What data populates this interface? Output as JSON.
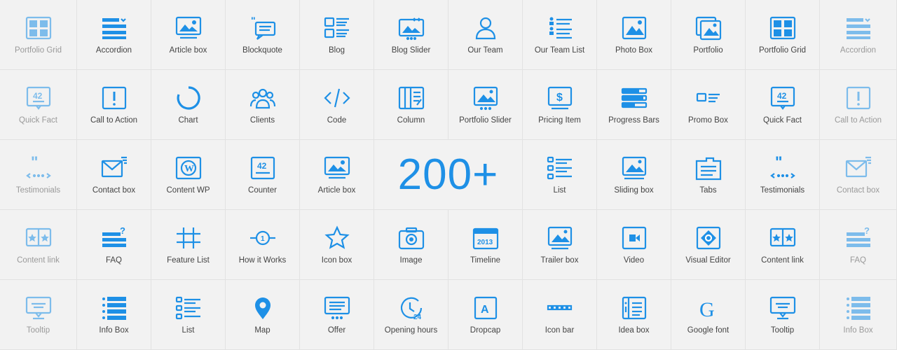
{
  "accent": "#1e90e6",
  "headline": "200+",
  "rows": [
    [
      {
        "label": "Portfolio Grid",
        "icon": "portfolio-grid",
        "faded": true
      },
      {
        "label": "Accordion",
        "icon": "accordion"
      },
      {
        "label": "Article box",
        "icon": "article-box"
      },
      {
        "label": "Blockquote",
        "icon": "blockquote"
      },
      {
        "label": "Blog",
        "icon": "blog"
      },
      {
        "label": "Blog Slider",
        "icon": "blog-slider"
      },
      {
        "label": "Our Team",
        "icon": "our-team"
      },
      {
        "label": "Our Team List",
        "icon": "our-team-list"
      },
      {
        "label": "Photo Box",
        "icon": "photo-box"
      },
      {
        "label": "Portfolio",
        "icon": "portfolio"
      },
      {
        "label": "Portfolio Grid",
        "icon": "portfolio-grid"
      },
      {
        "label": "Accordion",
        "icon": "accordion",
        "faded": true
      }
    ],
    [
      {
        "label": "Quick Fact",
        "icon": "quick-fact",
        "faded": true
      },
      {
        "label": "Call to Action",
        "icon": "call-to-action"
      },
      {
        "label": "Chart",
        "icon": "chart"
      },
      {
        "label": "Clients",
        "icon": "clients"
      },
      {
        "label": "Code",
        "icon": "code"
      },
      {
        "label": "Column",
        "icon": "column"
      },
      {
        "label": "Portfolio Slider",
        "icon": "portfolio-slider"
      },
      {
        "label": "Pricing Item",
        "icon": "pricing-item"
      },
      {
        "label": "Progress Bars",
        "icon": "progress-bars"
      },
      {
        "label": "Promo Box",
        "icon": "promo-box"
      },
      {
        "label": "Quick Fact",
        "icon": "quick-fact"
      },
      {
        "label": "Call to Action",
        "icon": "call-to-action",
        "faded": true
      }
    ],
    [
      {
        "label": "Testimonials",
        "icon": "testimonials",
        "faded": true
      },
      {
        "label": "Contact box",
        "icon": "contact-box"
      },
      {
        "label": "Content WP",
        "icon": "content-wp"
      },
      {
        "label": "Counter",
        "icon": "counter"
      },
      {
        "label": "Article box",
        "icon": "article-box"
      },
      null,
      null,
      {
        "label": "List",
        "icon": "list"
      },
      {
        "label": "Sliding box",
        "icon": "sliding-box"
      },
      {
        "label": "Tabs",
        "icon": "tabs"
      },
      {
        "label": "Testimonials",
        "icon": "testimonials"
      },
      {
        "label": "Contact box",
        "icon": "contact-box",
        "faded": true
      }
    ],
    [
      {
        "label": "Content link",
        "icon": "content-link",
        "faded": true
      },
      {
        "label": "FAQ",
        "icon": "faq"
      },
      {
        "label": "Feature List",
        "icon": "feature-list"
      },
      {
        "label": "How it Works",
        "icon": "how-it-works"
      },
      {
        "label": "Icon box",
        "icon": "icon-box"
      },
      {
        "label": "Image",
        "icon": "image"
      },
      {
        "label": "Timeline",
        "icon": "timeline"
      },
      {
        "label": "Trailer box",
        "icon": "trailer-box"
      },
      {
        "label": "Video",
        "icon": "video"
      },
      {
        "label": "Visual Editor",
        "icon": "visual-editor"
      },
      {
        "label": "Content link",
        "icon": "content-link"
      },
      {
        "label": "FAQ",
        "icon": "faq",
        "faded": true
      }
    ],
    [
      {
        "label": "Tooltip",
        "icon": "tooltip",
        "faded": true
      },
      {
        "label": "Info Box",
        "icon": "info-box"
      },
      {
        "label": "List",
        "icon": "list"
      },
      {
        "label": "Map",
        "icon": "map"
      },
      {
        "label": "Offer",
        "icon": "offer"
      },
      {
        "label": "Opening hours",
        "icon": "opening-hours"
      },
      {
        "label": "Dropcap",
        "icon": "dropcap"
      },
      {
        "label": "Icon bar",
        "icon": "icon-bar"
      },
      {
        "label": "Idea box",
        "icon": "idea-box"
      },
      {
        "label": "Google font",
        "icon": "google-font"
      },
      {
        "label": "Tooltip",
        "icon": "tooltip"
      },
      {
        "label": "Info Box",
        "icon": "info-box",
        "faded": true
      }
    ]
  ]
}
